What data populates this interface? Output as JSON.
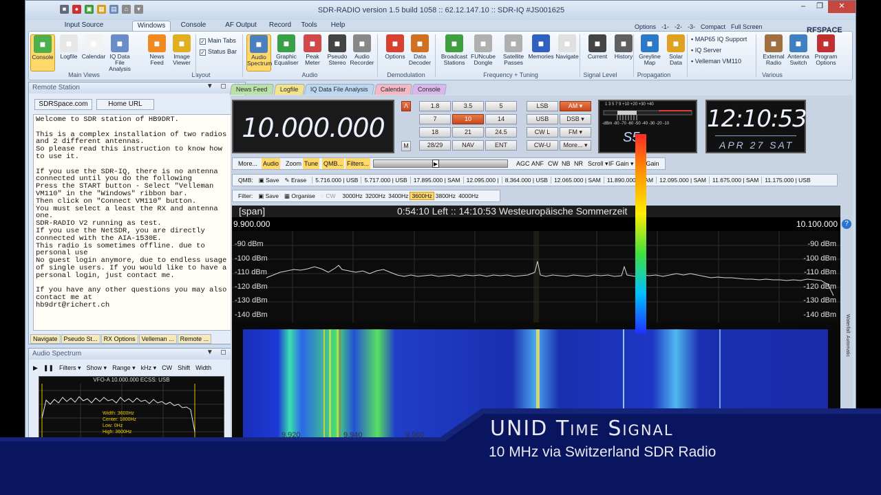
{
  "window": {
    "title": "SDR-RADIO version 1.5 build 1058 :: 62.12.147.10 :: SDR-IQ #JS001625"
  },
  "ribbon_tabs": [
    "Input Source",
    "Windows",
    "Console",
    "AF Output",
    "Record",
    "Tools",
    "Help"
  ],
  "ribbon_right": {
    "options": "Options",
    "one": "-1-",
    "two": "-2-",
    "three": "-3-",
    "compact": "Compact",
    "full_screen": "Full Screen",
    "logo": "RFSPACE"
  },
  "ribbon": {
    "main_views": [
      {
        "label": "Console"
      },
      {
        "label": "Logfile"
      },
      {
        "label": "Calendar"
      },
      {
        "label": "IQ Data File\nAnalysis"
      },
      {
        "label": "News\nFeed"
      },
      {
        "label": "Image\nViewer"
      }
    ],
    "layout": [
      {
        "label": "Main Tabs",
        "checked": true
      },
      {
        "label": "Status Bar",
        "checked": true
      }
    ],
    "audio": [
      {
        "label": "Audio\nSpectrum"
      },
      {
        "label": "Graphic\nEqualiser"
      },
      {
        "label": "Peak\nMeter"
      },
      {
        "label": "Pseudo\nStereo"
      },
      {
        "label": "Audio\nRecorder"
      }
    ],
    "demodulation": [
      {
        "label": "Options"
      },
      {
        "label": "Data\nDecoder"
      }
    ],
    "freq_tuning": [
      {
        "label": "Broadcast\nStations"
      },
      {
        "label": "FUNcube\nDongle"
      },
      {
        "label": "Satellite\nPasses"
      },
      {
        "label": "Memories"
      },
      {
        "label": "Navigate"
      }
    ],
    "signal_level": [
      {
        "label": "Current"
      },
      {
        "label": "History"
      }
    ],
    "propagation": [
      {
        "label": "Greyline\nMap"
      },
      {
        "label": "Solar\nData"
      }
    ],
    "various_list": [
      "MAP65 IQ Support",
      "IQ Server",
      "Velleman VM110"
    ],
    "various": [
      {
        "label": "External\nRadio"
      },
      {
        "label": "Antenna\nSwitch"
      },
      {
        "label": "Program\nOptions"
      }
    ],
    "groups": [
      "Main Views",
      "Layout",
      "Audio",
      "Demodulation",
      "Frequency + Tuning",
      "Signal Level",
      "Propagation",
      "Various"
    ]
  },
  "remote_station": {
    "title": "Remote Station",
    "buttons": [
      "SDRSpace.com",
      "Home URL"
    ],
    "text": "Welcome to SDR station of HB9DRT.\n\nThis is a complex installation of two radios and 2 different antennas.\nSo please read this instruction to know how to use it.\n\nIf you use the SDR-IQ, there is no antenna connected until you do the following\nPress the START button - Select \"Velleman VM110\" in the \"Windows\" ribbon bar.\nThen click on \"Connect VM110\" button.\nYou must select a least the RX and antenna one.\nSDR-RADIO V2 running as test.\nIf you use the NetSDR, you are directly connected with the AIA-1530E.\nThis radio is sometimes offline. due to personal use\nNo guest login anymore, due to endless usage of single users. If you would like to have a personal login, just contact me.\n\nIf you have any other questions you may also contact me at\nhb9drt@richert.ch",
    "bottom_tabs": [
      "Navigate",
      "Pseudo St...",
      "RX Options",
      "Velleman ...",
      "Remote ..."
    ]
  },
  "audio_spectrum": {
    "title": "Audio Spectrum",
    "tools": [
      "Filters",
      "Show",
      "Range",
      "kHz",
      "CW",
      "Shift",
      "Width"
    ],
    "header": "VFO-A  10.000.000  ECSS: USB",
    "info": [
      {
        "k": "Width:",
        "v": "3600Hz"
      },
      {
        "k": "Center:",
        "v": "1800Hz"
      },
      {
        "k": "Low:",
        "v": "0Hz"
      },
      {
        "k": "High:",
        "v": "3600Hz"
      }
    ]
  },
  "doc_tabs": [
    "News Feed",
    "Logfile",
    "IQ Data File Analysis",
    "Calendar",
    "Console"
  ],
  "console": {
    "frequency": "10.000.000",
    "lock_btn": "Λ",
    "m_btn": "M",
    "band_buttons": [
      "1.8",
      "3.5",
      "5",
      "7",
      "10",
      "14",
      "18",
      "21",
      "24.5",
      "28/29",
      "NAV",
      "ENT"
    ],
    "active_band": "10",
    "mode_buttons": [
      "LSB",
      "AM",
      "USB",
      "DSB",
      "CW L",
      "FM",
      "CW-U",
      "More..."
    ],
    "active_mode": "AM",
    "smeter_reading": "S5",
    "smeter_scale": "1  3  5  7  9  +10 +20 +30 +40",
    "smeter_db": "-dBm  -80 -70 -60 -50 -40 -30 -20 -10",
    "clock_time": "12:10:53",
    "clock_date": "APR 27  SAT",
    "more_bar": [
      "More...",
      "Audio",
      "Zoom",
      "Tune",
      "QMB...",
      "Filters...",
      "AGC",
      "ANF",
      "CW",
      "NB",
      "NR",
      "Scroll",
      "IF Gain",
      "RF Gain"
    ],
    "qmb": {
      "label": "QMB:",
      "save": "Save",
      "erase": "Erase",
      "entries": [
        "5.716.000 | USB",
        "5.717.000 | USB",
        "17.895.000 | SAM",
        "12.095.000 |",
        "8.364.000 | USB",
        "12.065.000 | SAM",
        "11.890.000 | SAM",
        "12.095.000 | SAM",
        "11.675.000 | SAM",
        "11.175.000 | USB"
      ]
    },
    "filter": {
      "label": "Filter:",
      "save": "Save",
      "organise": "Organise",
      "cw": "CW",
      "widths": [
        "3000Hz",
        "3200Hz",
        "3400Hz",
        "3600Hz",
        "3800Hz",
        "4000Hz"
      ],
      "selected": "3600Hz"
    }
  },
  "spectrum": {
    "span_label": "[span]",
    "status": "0:54:10 Left  ::  14:10:53 Westeuropäische Sommerzeit",
    "start_freq": "9.900.000",
    "end_freq": "10.100.000",
    "db_labels": [
      "-90 dBm",
      "-100 dBm",
      "-110 dBm",
      "-120 dBm",
      "-130 dBm",
      "-140 dBm"
    ],
    "freq_ticks": [
      "9.920",
      "9.940",
      "9.960"
    ],
    "waterfall_label": "Waterfall: Automatic"
  },
  "overlay": {
    "title": "UNID Time Signal",
    "subtitle": "10 MHz via Switzerland SDR Radio"
  },
  "colors": {
    "accent": "#ffd86a",
    "active_button": "#d9572a",
    "overlay_blue": "#0b1a66",
    "frame": "#cfdcec"
  }
}
